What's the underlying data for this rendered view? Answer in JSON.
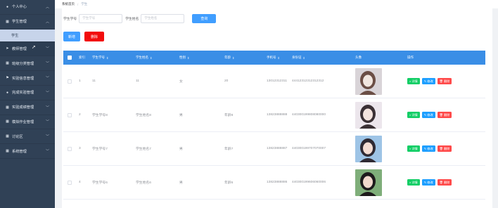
{
  "sidebar": {
    "items": [
      {
        "label": "个人中心",
        "icon": "user-icon",
        "glyph": "●",
        "expanded": true,
        "chev": "︿"
      },
      {
        "label": "学生管理",
        "icon": "grid-icon",
        "glyph": "▦",
        "expanded": true,
        "chev": "︿"
      },
      {
        "label": "学生",
        "sub": true
      },
      {
        "label": "教师管理",
        "icon": "send-icon",
        "glyph": "➤",
        "chev": "﹀"
      },
      {
        "label": "班级分类管理",
        "icon": "grid-icon",
        "glyph": "▦",
        "chev": "﹀"
      },
      {
        "label": "实验信息管理",
        "icon": "flag-icon",
        "glyph": "⚑",
        "chev": "﹀"
      },
      {
        "label": "完成实验管理",
        "icon": "person-icon",
        "glyph": "●",
        "chev": "﹀"
      },
      {
        "label": "实验成绩管理",
        "icon": "grid-icon",
        "glyph": "▦",
        "chev": "﹀"
      },
      {
        "label": "模拟作业管理",
        "icon": "grid-icon",
        "glyph": "▦",
        "chev": "﹀"
      },
      {
        "label": "讨论区",
        "icon": "grid-icon",
        "glyph": "▦",
        "chev": "﹀"
      },
      {
        "label": "系统管理",
        "icon": "grid-icon",
        "glyph": "▦",
        "chev": "﹀"
      }
    ]
  },
  "breadcrumb": {
    "home": "系统首页",
    "sep": "/",
    "current": "学生"
  },
  "search": {
    "student_no_label": "学生学号",
    "student_no_placeholder": "学生学号",
    "student_name_label": "学生姓名",
    "student_name_placeholder": "学生姓名",
    "query_label": "查询"
  },
  "actions": {
    "add_label": "新增",
    "delete_label": "删除"
  },
  "table": {
    "headers": [
      "索引",
      "学生学号",
      "学生姓名",
      "性别",
      "年龄",
      "手机号",
      "身份证",
      "头像",
      "操作"
    ],
    "sort_glyph": "⇕",
    "rows": [
      {
        "index": "1",
        "no": "11",
        "name": "11",
        "gender": "女",
        "age": "20",
        "phone": "13012312311",
        "idcard": "44412312312312312",
        "avatar_colors": [
          "#d9d4d8",
          "#6b4e45",
          "#f1e6df"
        ]
      },
      {
        "index": "2",
        "no": "学生学号8",
        "name": "学生姓名8",
        "gender": "男",
        "age": "年龄8",
        "phone": "13823888888",
        "idcard": "440300199808080000",
        "avatar_colors": [
          "#ece6ec",
          "#3a3034",
          "#f3e3dd"
        ]
      },
      {
        "index": "3",
        "no": "学生学号7",
        "name": "学生姓名7",
        "gender": "男",
        "age": "年龄7",
        "phone": "13823888887",
        "idcard": "440300199707070007",
        "avatar_colors": [
          "#9ec4e6",
          "#2f2a33",
          "#f4ddd3"
        ]
      },
      {
        "index": "4",
        "no": "学生学号6",
        "name": "学生姓名6",
        "gender": "男",
        "age": "年龄6",
        "phone": "13823888886",
        "idcard": "440300199606060006",
        "avatar_colors": [
          "#7fae7a",
          "#1d1a1c",
          "#f1d8cc"
        ]
      }
    ],
    "op_detail": "详情",
    "op_edit": "修改",
    "op_remove": "删除",
    "op_detail_icon": "⌕",
    "op_edit_icon": "✎",
    "op_remove_icon": "🗑"
  }
}
